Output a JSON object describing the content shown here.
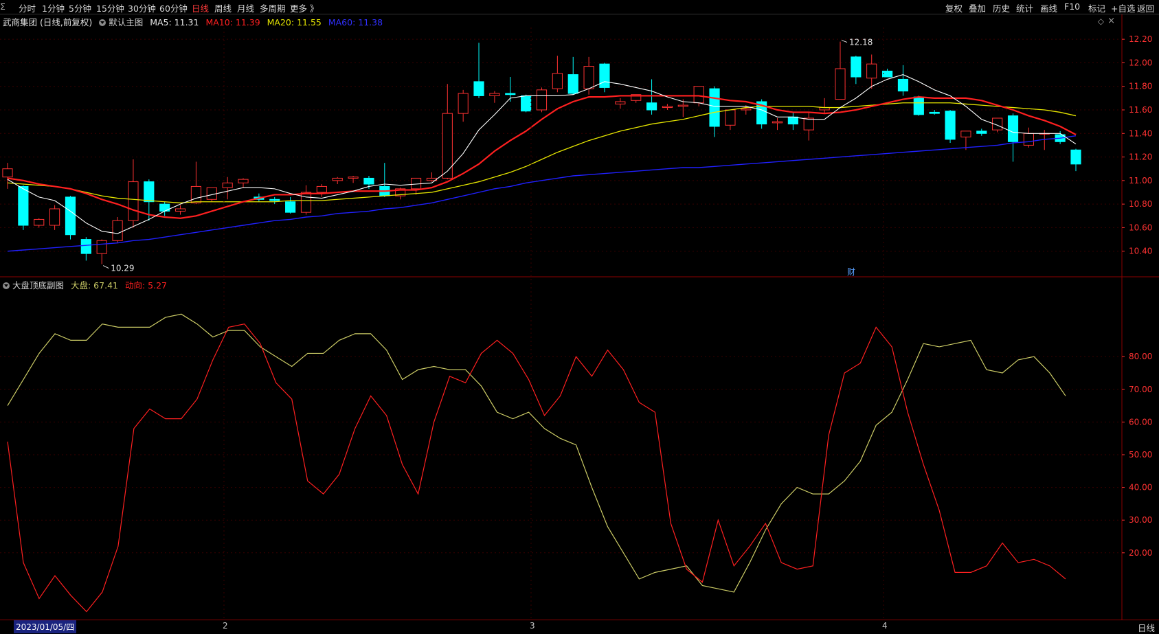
{
  "toolbar": {
    "left": [
      "分时",
      "1分钟",
      "5分钟",
      "15分钟",
      "30分钟",
      "60分钟",
      "日线",
      "周线",
      "月线",
      "多周期",
      "更多 》"
    ],
    "active": "日线",
    "right": [
      "复权",
      "叠加",
      "历史",
      "统计",
      "画线",
      "F10",
      "标记",
      "+自选",
      "返回"
    ]
  },
  "main_info": {
    "stock": "武商集团 (日线,前复权)",
    "template": "默认主图",
    "ma5": "MA5: 11.31",
    "ma10": "MA10: 11.39",
    "ma20": "MA20: 11.55",
    "ma60": "MA60: 11.38"
  },
  "indicator_info": {
    "name": "大盘顶底副图",
    "dapan": "大盘: 67.41",
    "dongxiang": "动向: 5.27"
  },
  "bottom": {
    "date": "2023/01/05/四",
    "months": [
      "2",
      "3",
      "4"
    ],
    "period": "日线"
  },
  "colors": {
    "up": "#ff3232",
    "down": "#00ffff",
    "ma5": "#ffffff",
    "ma10": "#ff2020",
    "ma20": "#e6e600",
    "ma60": "#2020ff",
    "dapan": "#cccc66",
    "dongxiang": "#ff2020",
    "axis": "#ff3232"
  },
  "chart_data": [
    {
      "type": "candlestick",
      "title": "武商集团 (日线,前复权)",
      "ylim": [
        10.2,
        12.3
      ],
      "yticks": [
        "12.20",
        "12.00",
        "11.80",
        "11.60",
        "11.40",
        "11.20",
        "11.00",
        "10.80",
        "10.60",
        "10.40"
      ],
      "annotations": [
        {
          "label": "12.18",
          "type": "high"
        },
        {
          "label": "10.29",
          "type": "low"
        },
        {
          "label": "财",
          "type": "marker"
        }
      ],
      "ohlc": [
        [
          11.03,
          11.15,
          10.93,
          11.1
        ],
        [
          10.95,
          10.96,
          10.58,
          10.62
        ],
        [
          10.62,
          10.68,
          10.6,
          10.67
        ],
        [
          10.62,
          10.79,
          10.58,
          10.76
        ],
        [
          10.86,
          10.87,
          10.5,
          10.54
        ],
        [
          10.5,
          10.52,
          10.32,
          10.38
        ],
        [
          10.38,
          10.5,
          10.29,
          10.49
        ],
        [
          10.49,
          10.69,
          10.47,
          10.66
        ],
        [
          10.66,
          11.18,
          10.6,
          10.99
        ],
        [
          10.99,
          11.01,
          10.66,
          10.82
        ],
        [
          10.8,
          10.82,
          10.7,
          10.74
        ],
        [
          10.74,
          10.79,
          10.71,
          10.76
        ],
        [
          10.81,
          11.16,
          10.8,
          10.95
        ],
        [
          10.84,
          10.94,
          10.82,
          10.94
        ],
        [
          10.94,
          11.03,
          10.84,
          10.98
        ],
        [
          10.98,
          11.02,
          10.94,
          11.01
        ],
        [
          10.86,
          10.89,
          10.82,
          10.84
        ],
        [
          10.84,
          10.86,
          10.8,
          10.83
        ],
        [
          10.82,
          10.86,
          10.72,
          10.73
        ],
        [
          10.73,
          10.96,
          10.71,
          10.9
        ],
        [
          10.9,
          10.97,
          10.86,
          10.95
        ],
        [
          11.0,
          11.03,
          10.97,
          11.02
        ],
        [
          11.02,
          11.04,
          10.98,
          11.03
        ],
        [
          11.02,
          11.04,
          10.93,
          10.97
        ],
        [
          10.95,
          11.15,
          10.86,
          10.87
        ],
        [
          10.87,
          10.94,
          10.84,
          10.93
        ],
        [
          10.93,
          11.01,
          10.88,
          11.02
        ],
        [
          11.0,
          11.07,
          10.99,
          11.02
        ],
        [
          11.02,
          11.82,
          11.01,
          11.57
        ],
        [
          11.57,
          11.77,
          11.5,
          11.74
        ],
        [
          11.84,
          12.17,
          11.7,
          11.72
        ],
        [
          11.72,
          11.76,
          11.66,
          11.74
        ],
        [
          11.74,
          11.88,
          11.67,
          11.73
        ],
        [
          11.72,
          11.73,
          11.58,
          11.59
        ],
        [
          11.6,
          11.79,
          11.58,
          11.77
        ],
        [
          11.78,
          12.06,
          11.75,
          11.91
        ],
        [
          11.9,
          12.05,
          11.73,
          11.74
        ],
        [
          11.78,
          12.05,
          11.73,
          11.97
        ],
        [
          11.99,
          12.0,
          11.75,
          11.79
        ],
        [
          11.65,
          11.7,
          11.61,
          11.67
        ],
        [
          11.68,
          11.73,
          11.66,
          11.73
        ],
        [
          11.66,
          11.86,
          11.56,
          11.6
        ],
        [
          11.62,
          11.65,
          11.6,
          11.63
        ],
        [
          11.63,
          11.69,
          11.54,
          11.64
        ],
        [
          11.66,
          11.8,
          11.63,
          11.8
        ],
        [
          11.78,
          11.8,
          11.37,
          11.46
        ],
        [
          11.47,
          11.6,
          11.43,
          11.6
        ],
        [
          11.6,
          11.64,
          11.56,
          11.61
        ],
        [
          11.67,
          11.69,
          11.44,
          11.48
        ],
        [
          11.49,
          11.53,
          11.43,
          11.5
        ],
        [
          11.54,
          11.58,
          11.43,
          11.48
        ],
        [
          11.43,
          11.58,
          11.34,
          11.53
        ],
        [
          11.6,
          11.7,
          11.57,
          11.62
        ],
        [
          11.69,
          12.18,
          11.69,
          11.95
        ],
        [
          12.05,
          12.06,
          11.82,
          11.88
        ],
        [
          11.87,
          12.07,
          11.78,
          11.99
        ],
        [
          11.93,
          11.95,
          11.88,
          11.88
        ],
        [
          11.86,
          11.98,
          11.72,
          11.76
        ],
        [
          11.71,
          11.72,
          11.55,
          11.56
        ],
        [
          11.58,
          11.6,
          11.56,
          11.57
        ],
        [
          11.59,
          11.6,
          11.32,
          11.35
        ],
        [
          11.37,
          11.42,
          11.26,
          11.42
        ],
        [
          11.42,
          11.44,
          11.38,
          11.4
        ],
        [
          11.43,
          11.53,
          11.41,
          11.53
        ],
        [
          11.55,
          11.57,
          11.16,
          11.33
        ],
        [
          11.3,
          11.45,
          11.28,
          11.4
        ],
        [
          11.4,
          11.43,
          11.26,
          11.4
        ],
        [
          11.39,
          11.42,
          11.31,
          11.33
        ],
        [
          11.26,
          11.27,
          11.08,
          11.14
        ]
      ],
      "ma5": [
        11.01,
        10.93,
        10.86,
        10.83,
        10.74,
        10.64,
        10.57,
        10.55,
        10.61,
        10.67,
        10.74,
        10.8,
        10.85,
        10.88,
        10.91,
        10.94,
        10.94,
        10.93,
        10.89,
        10.86,
        10.85,
        10.88,
        10.91,
        10.95,
        10.97,
        10.96,
        10.97,
        10.98,
        11.08,
        11.23,
        11.43,
        11.56,
        11.7,
        11.72,
        11.72,
        11.72,
        11.73,
        11.78,
        11.84,
        11.82,
        11.79,
        11.76,
        11.71,
        11.67,
        11.66,
        11.63,
        11.63,
        11.63,
        11.6,
        11.54,
        11.54,
        11.52,
        11.52,
        11.62,
        11.7,
        11.8,
        11.86,
        11.9,
        11.84,
        11.77,
        11.72,
        11.63,
        11.52,
        11.47,
        11.41,
        11.4,
        11.4,
        11.4,
        11.31
      ],
      "ma10": [
        11.02,
        11.0,
        10.97,
        10.95,
        10.93,
        10.89,
        10.84,
        10.8,
        10.75,
        10.71,
        10.69,
        10.68,
        10.7,
        10.74,
        10.78,
        10.82,
        10.85,
        10.88,
        10.88,
        10.89,
        10.89,
        10.9,
        10.91,
        10.91,
        10.91,
        10.92,
        10.92,
        10.94,
        10.99,
        11.06,
        11.14,
        11.25,
        11.34,
        11.42,
        11.52,
        11.61,
        11.67,
        11.71,
        11.71,
        11.72,
        11.72,
        11.72,
        11.72,
        11.72,
        11.72,
        11.7,
        11.68,
        11.67,
        11.64,
        11.6,
        11.58,
        11.58,
        11.57,
        11.58,
        11.6,
        11.63,
        11.66,
        11.69,
        11.71,
        11.7,
        11.7,
        11.7,
        11.68,
        11.64,
        11.6,
        11.55,
        11.51,
        11.46,
        11.39
      ],
      "ma20": [
        10.98,
        10.97,
        10.96,
        10.95,
        10.93,
        10.9,
        10.87,
        10.85,
        10.84,
        10.83,
        10.82,
        10.81,
        10.82,
        10.82,
        10.82,
        10.82,
        10.82,
        10.82,
        10.83,
        10.83,
        10.83,
        10.84,
        10.85,
        10.86,
        10.87,
        10.88,
        10.89,
        10.9,
        10.93,
        10.96,
        10.99,
        11.03,
        11.07,
        11.12,
        11.18,
        11.24,
        11.29,
        11.34,
        11.38,
        11.42,
        11.45,
        11.48,
        11.5,
        11.52,
        11.55,
        11.58,
        11.6,
        11.62,
        11.63,
        11.63,
        11.63,
        11.63,
        11.62,
        11.62,
        11.63,
        11.64,
        11.65,
        11.66,
        11.66,
        11.66,
        11.66,
        11.65,
        11.64,
        11.63,
        11.62,
        11.61,
        11.6,
        11.58,
        11.55
      ],
      "ma60": [
        10.4,
        10.41,
        10.42,
        10.43,
        10.44,
        10.45,
        10.46,
        10.47,
        10.49,
        10.5,
        10.52,
        10.54,
        10.56,
        10.58,
        10.6,
        10.62,
        10.64,
        10.66,
        10.67,
        10.69,
        10.7,
        10.72,
        10.73,
        10.74,
        10.76,
        10.77,
        10.79,
        10.81,
        10.84,
        10.87,
        10.9,
        10.93,
        10.95,
        10.98,
        11.0,
        11.02,
        11.04,
        11.05,
        11.06,
        11.07,
        11.08,
        11.09,
        11.1,
        11.11,
        11.11,
        11.12,
        11.13,
        11.14,
        11.15,
        11.16,
        11.17,
        11.18,
        11.19,
        11.2,
        11.21,
        11.22,
        11.23,
        11.24,
        11.25,
        11.26,
        11.27,
        11.28,
        11.29,
        11.3,
        11.32,
        11.33,
        11.35,
        11.36,
        11.38
      ]
    },
    {
      "type": "line",
      "title": "大盘顶底副图",
      "ylim": [
        0,
        100
      ],
      "yticks": [
        "80.00",
        "70.00",
        "60.00",
        "50.00",
        "40.00",
        "30.00",
        "20.00"
      ],
      "series": [
        {
          "name": "大盘",
          "values": [
            65,
            73,
            81,
            87,
            85,
            85,
            90,
            89,
            89,
            89,
            92,
            93,
            90,
            86,
            88,
            88,
            83,
            80,
            77,
            81,
            81,
            85,
            87,
            87,
            82,
            73,
            76,
            77,
            76,
            76,
            71,
            63,
            61,
            63,
            58,
            55,
            53,
            40,
            28,
            20,
            12,
            14,
            15,
            16,
            10,
            9,
            8,
            17,
            27,
            35,
            40,
            38,
            38,
            42,
            48,
            59,
            63,
            73,
            84,
            83,
            84,
            85,
            76,
            75,
            79,
            80,
            75,
            68
          ]
        },
        {
          "name": "动向",
          "values": [
            54,
            17,
            6,
            13,
            7,
            2,
            8,
            22,
            58,
            64,
            61,
            61,
            67,
            79,
            89,
            90,
            84,
            72,
            67,
            42,
            38,
            44,
            58,
            68,
            62,
            47,
            38,
            60,
            74,
            72,
            81,
            85,
            81,
            73,
            62,
            68,
            80,
            74,
            82,
            76,
            66,
            63,
            29,
            15,
            11,
            30,
            16,
            22,
            29,
            17,
            15,
            16,
            56,
            75,
            78,
            89,
            83,
            63,
            47,
            33,
            14,
            14,
            16,
            23,
            17,
            18,
            16,
            12
          ]
        }
      ]
    }
  ]
}
